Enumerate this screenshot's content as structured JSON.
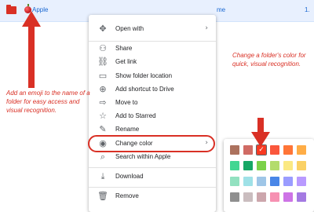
{
  "file_row": {
    "name": "Apple",
    "owner": "me",
    "size": "1."
  },
  "menu": {
    "items": [
      {
        "label": "Open with",
        "icon": "move-arrows-icon",
        "glyph": "✥",
        "has_submenu": true
      },
      {
        "label": "Share",
        "icon": "person-add-icon",
        "glyph": "⚇"
      },
      {
        "label": "Get link",
        "icon": "link-icon",
        "glyph": "⛓"
      },
      {
        "label": "Show folder location",
        "icon": "folder-outline-icon",
        "glyph": "▭"
      },
      {
        "label": "Add shortcut to Drive",
        "icon": "add-shortcut-icon",
        "glyph": "⊕"
      },
      {
        "label": "Move to",
        "icon": "move-folder-icon",
        "glyph": "⇨"
      },
      {
        "label": "Add to Starred",
        "icon": "star-outline-icon",
        "glyph": "☆"
      },
      {
        "label": "Rename",
        "icon": "pencil-icon",
        "glyph": "✎"
      },
      {
        "label": "Change color",
        "icon": "palette-icon",
        "glyph": "◉",
        "has_submenu": true,
        "highlighted": true
      },
      {
        "label": "Search within Apple",
        "icon": "search-icon",
        "glyph": "⌕"
      },
      {
        "label": "Download",
        "icon": "download-icon",
        "glyph": "⤓"
      },
      {
        "label": "Remove",
        "icon": "trash-icon",
        "glyph": "🗑"
      }
    ],
    "chevron": "›"
  },
  "palette": {
    "rows": [
      [
        "#ac725e",
        "#d06b64",
        "#f83a22",
        "#fa573c",
        "#ff7537",
        "#ffad46"
      ],
      [
        "#42d692",
        "#16a765",
        "#7bd148",
        "#b3dc6c",
        "#fbe983",
        "#fad165"
      ],
      [
        "#92e1c0",
        "#9fe1e7",
        "#9fc6e7",
        "#4986e7",
        "#9a9cff",
        "#b99aff"
      ],
      [
        "#8f8f8f",
        "#cabdbf",
        "#cca6ac",
        "#f691b2",
        "#cd74e6",
        "#a47ae2"
      ]
    ],
    "selected": {
      "row": 0,
      "col": 2
    },
    "check_glyph": "✓"
  },
  "annotations": {
    "left_note": "Add an emoji to the name of a folder for easy access and visual recognition.",
    "right_note": "Change a folder's color for quick, visual recognition."
  },
  "colors": {
    "accent": "#d93025",
    "selection_bg": "#e8f0fe",
    "link_text": "#1967d2"
  }
}
